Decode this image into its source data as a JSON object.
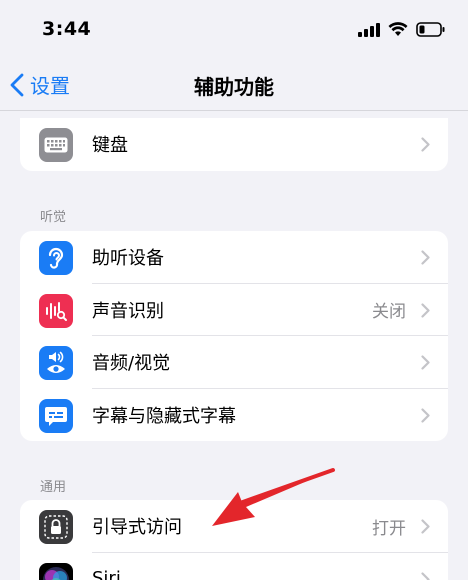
{
  "status_bar": {
    "time": "3:44"
  },
  "nav": {
    "back_label": "设置",
    "title": "辅助功能"
  },
  "groups": {
    "top": {
      "items": [
        {
          "label": "键盘",
          "value": "",
          "icon": "keyboard-icon",
          "color": "#8e8e93"
        }
      ]
    },
    "hearing": {
      "header": "听觉",
      "items": [
        {
          "label": "助听设备",
          "value": "",
          "icon": "ear-icon",
          "color": "#1a7cf5"
        },
        {
          "label": "声音识别",
          "value": "关闭",
          "icon": "sound-recognition-icon",
          "color": "#ee2f52"
        },
        {
          "label": "音频/视觉",
          "value": "",
          "icon": "audio-visual-icon",
          "color": "#1a7cf5"
        },
        {
          "label": "字幕与隐藏式字幕",
          "value": "",
          "icon": "captions-icon",
          "color": "#1a7cf5"
        }
      ]
    },
    "general": {
      "header": "通用",
      "items": [
        {
          "label": "引导式访问",
          "value": "打开",
          "icon": "lock-icon",
          "color": "#3a3a3c"
        },
        {
          "label": "Siri",
          "value": "",
          "icon": "siri-icon",
          "color": "#000000"
        }
      ]
    }
  },
  "colors": {
    "accent": "#1a7cf5",
    "annotation_arrow": "#e3262b"
  }
}
